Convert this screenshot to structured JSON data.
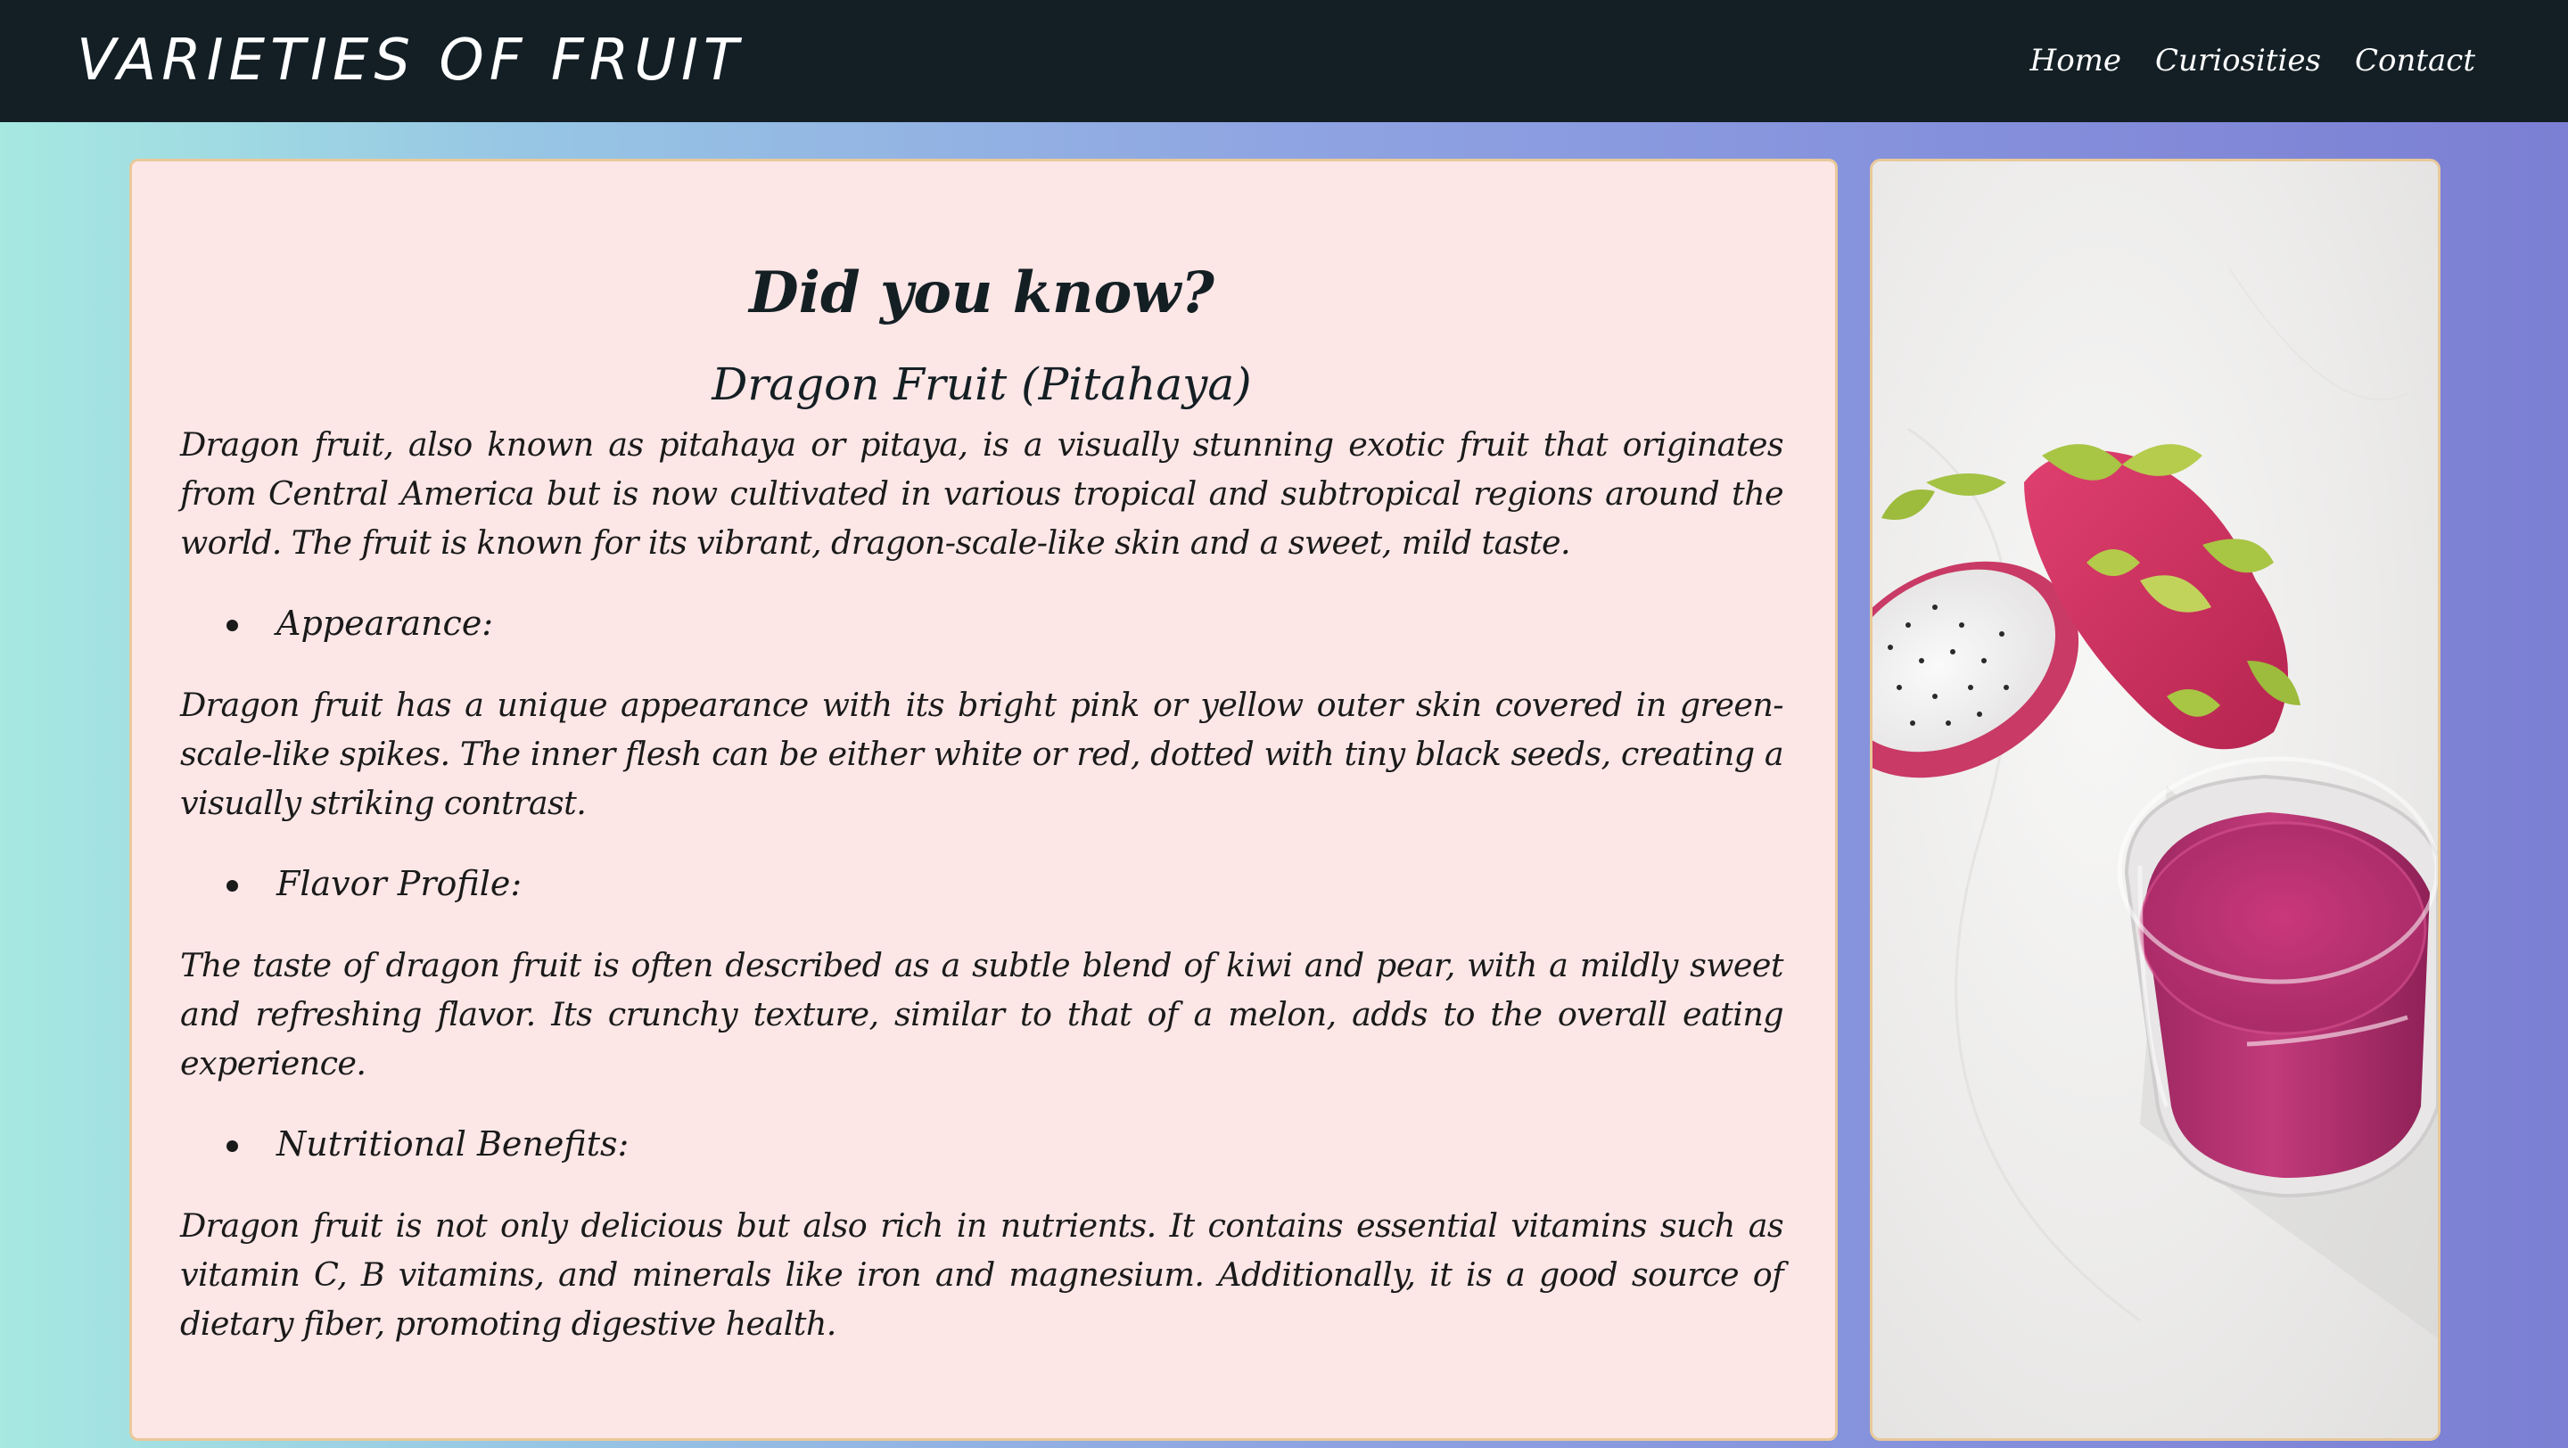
{
  "navbar": {
    "brand": "VARIETIES OF FRUIT",
    "links": [
      "Home",
      "Curiosities",
      "Contact"
    ]
  },
  "article": {
    "title": "Did you know?",
    "subtitle": "Dragon Fruit (Pitahaya)",
    "intro": "Dragon fruit, also known as pitahaya or pitaya, is a visually stunning exotic fruit that originates from Central America but is now cultivated in various tropical and subtropical regions around the world. The fruit is known for its vibrant, dragon-scale-like skin and a sweet, mild taste.",
    "sections": [
      {
        "heading": "Appearance:",
        "text": "Dragon fruit has a unique appearance with its bright pink or yellow outer skin covered in green-scale-like spikes. The inner flesh can be either white or red, dotted with tiny black seeds, creating a visually striking contrast."
      },
      {
        "heading": "Flavor Profile:",
        "text": "The taste of dragon fruit is often described as a subtle blend of kiwi and pear, with a mildly sweet and refreshing flavor. Its crunchy texture, similar to that of a melon, adds to the overall eating experience."
      },
      {
        "heading": "Nutritional Benefits:",
        "text": "Dragon fruit is not only delicious but also rich in nutrients. It contains essential vitamins such as vitamin C, B vitamins, and minerals like iron and magnesium. Additionally, it is a good source of dietary fiber, promoting digestive health."
      }
    ]
  },
  "colors": {
    "navbar": "#131f25",
    "card_background": "#fce6e6",
    "card_border": "#e8c99a",
    "dragon_fruit_skin": "#d8336a",
    "smoothie": "#b8316f"
  }
}
